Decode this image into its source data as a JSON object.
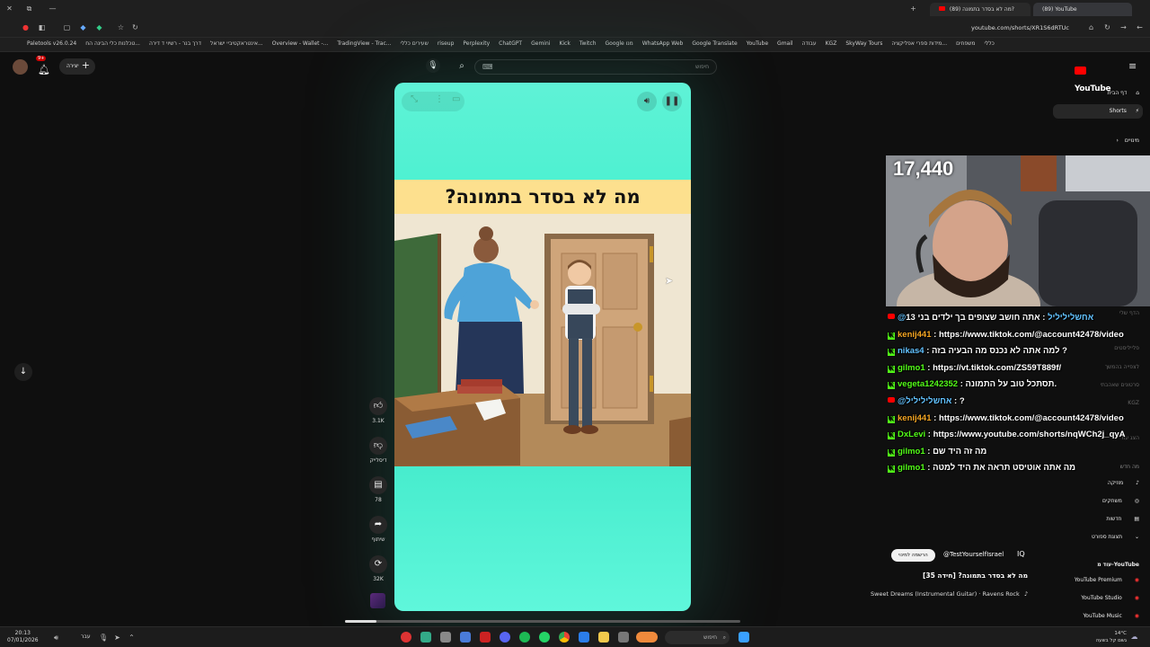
{
  "browser": {
    "tabs": [
      {
        "label": "(89) YouTube"
      },
      {
        "label": "(89) מה לא בסדר בתמונה?"
      }
    ],
    "url": "youtube.com/shorts/XR1S6dRTUc",
    "bookmarks": [
      "Paletools v26.0.24",
      "טכלנות כלי הבינה הח...",
      "דרך בנר - רשיוי ד דירה",
      "אינטראקטיביי ישראל...",
      "Overview - Wallet -...",
      "TradingView - Trac...",
      "שעירים כללי",
      "riseup",
      "Perplexity",
      "ChatGPT",
      "Gemini",
      "Kick",
      "Twitch",
      "Google מנו",
      "WhatsApp Web",
      "Google Translate",
      "YouTube",
      "Gmail",
      "עבודה",
      "KGZ",
      "SkyWay Tours",
      "מידות ספרי אפליקציה...",
      "משפחים",
      "כללי"
    ]
  },
  "header": {
    "create_label": "יצירה",
    "search_placeholder": "חיפוש",
    "logo_text": "YouTube",
    "notif_count": "9+"
  },
  "sidebar": {
    "items": [
      {
        "label": "דף הבית"
      },
      {
        "label": "Shorts"
      },
      {
        "label": "מינויים"
      }
    ],
    "more_from": "עוד מ-YouTube",
    "more_items": [
      {
        "label": "YouTube Premium"
      },
      {
        "label": "YouTube Studio"
      },
      {
        "label": "YouTube Music"
      }
    ],
    "explore_items": [
      {
        "label": "מוזיקה"
      },
      {
        "label": "משחקים"
      },
      {
        "label": "חדשות"
      },
      {
        "label": "תצוגת ספורט"
      }
    ],
    "faded_items": [
      "הדף שלי",
      "פלייליסטים",
      "לצפייה בהמשך",
      "סרטונים שאהבתי",
      "KGZ",
      "הצג עוד",
      "מה חדש"
    ]
  },
  "short": {
    "title_overlay": "מה לא בסדר בתמונה?",
    "channel": "@TestYourselfIsrael",
    "subscribe_label": "הרשמה למינוי",
    "title": "מה לא בסדר בתמונה? [חידה 35]",
    "music": "Sweet Dreams (Instrumental Guitar) · Ravens Rock"
  },
  "actions": [
    {
      "name": "like",
      "label": "3.1K"
    },
    {
      "name": "dislike",
      "label": "דיסלייק"
    },
    {
      "name": "comments",
      "label": "78"
    },
    {
      "name": "share",
      "label": "שיתוף"
    },
    {
      "name": "remix",
      "label": "32K"
    }
  ],
  "overlay": {
    "viewer_count": "17,440",
    "chat": [
      {
        "platform": "yt",
        "user": "@אחשליליליל",
        "text": "אתה חושב שצופים בך ילדים בני 13",
        "color": "#62c2ff"
      },
      {
        "platform": "kick",
        "user": "kenij441",
        "text": "https://www.tiktok.com/@account42478/video",
        "color": "#f5a623"
      },
      {
        "platform": "kick",
        "user": "nikas4",
        "text": "למה אתה לא נכנס מה הבעיה בזה ?",
        "color": "#62c2ff"
      },
      {
        "platform": "kick",
        "user": "gilmo1",
        "text": "https://vt.tiktok.com/ZS59T889f/",
        "color": "#53fc18"
      },
      {
        "platform": "kick",
        "user": "vegeta1242352",
        "text": "תסתכל טוב על התמונה.",
        "color": "#53fc18"
      },
      {
        "platform": "yt",
        "user": "@אחשליליליל",
        "text": "?",
        "color": "#62c2ff"
      },
      {
        "platform": "kick",
        "user": "kenij441",
        "text": "https://www.tiktok.com/@account42478/video",
        "color": "#f5a623"
      },
      {
        "platform": "kick",
        "user": "DxLevi",
        "text": "https://www.youtube.com/shorts/nqWCh2j_qyA",
        "color": "#53fc18"
      },
      {
        "platform": "kick",
        "user": "gilmo1",
        "text": "מה זה היד שם",
        "color": "#53fc18"
      },
      {
        "platform": "kick",
        "user": "gilmo1",
        "text": "מה אתה אוטיסט תראה את היד למטה",
        "color": "#53fc18"
      }
    ]
  },
  "taskbar": {
    "search_label": "חיפוש",
    "time": "20:13",
    "date": "07/01/2026",
    "weather": "14°C",
    "weather_desc": "גשם קל בשעה"
  }
}
